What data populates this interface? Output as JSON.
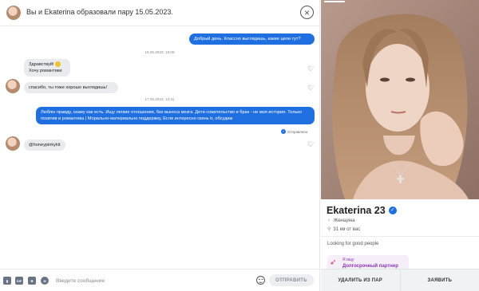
{
  "header": {
    "title": "Вы и Ekaterina образовали пару 15.05.2023.",
    "close_icon": "close-circle-icon"
  },
  "messages": {
    "out1": "Добрый день. Классно выглядишь, какие цели тут?",
    "ts1": "15.05.2023, 15:08",
    "in1_line1": "Здравствуй!",
    "in1_line2": "Хочу романтики",
    "in2": "спасибо, ты тоже хорошо выглядишь!",
    "ts2": "17.05.2023, 12:31",
    "out2": "Люблю правду, скажу как есть. Ищу легкие отношения, без выноса мозга. Дети сожительство и брак - не моя история. Только позитив и романтика | Морально-материально поддержку, Если интересно скинь tr, обсудим",
    "status": "Отправлено",
    "in3": "@honeypinkykit"
  },
  "composer": {
    "placeholder": "Введите сообщение",
    "gif_label": "GIF",
    "send_label": "ОТПРАВИТЬ"
  },
  "profile": {
    "name_age": "Ekaterina 23",
    "gender": "Женщина",
    "distance": "31 км от вас",
    "about": "Looking for good people",
    "goal_label": "Я ищу",
    "goal_value": "Долгосрочный партнер",
    "unmatch_label": "УДАЛИТЬ ИЗ ПАР",
    "report_label": "ЗАЯВИТЬ"
  },
  "colors": {
    "accent": "#1f6fe0",
    "incoming_bubble": "#e9ebef",
    "goal_text": "#8a35b8"
  }
}
